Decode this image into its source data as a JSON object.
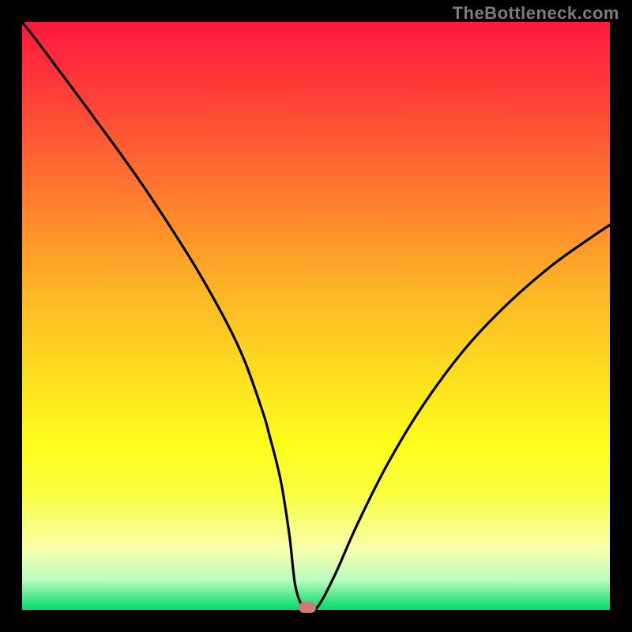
{
  "watermark": "TheBottleneck.com",
  "chart_data": {
    "type": "line",
    "title": "",
    "xlabel": "",
    "ylabel": "",
    "xlim": [
      0,
      100
    ],
    "ylim": [
      0,
      100
    ],
    "series": [
      {
        "name": "curve",
        "x": [
          0,
          2,
          5,
          10,
          15,
          20,
          25,
          30,
          35,
          38,
          41,
          42,
          44,
          45.5,
          46.5,
          48,
          50,
          53,
          57,
          62,
          68,
          75,
          82,
          90,
          97,
          100
        ],
        "values": [
          100,
          97.5,
          93.5,
          86.8,
          80,
          73,
          65.5,
          57.5,
          48.5,
          42,
          33.5,
          30,
          22,
          12.5,
          4,
          0.2,
          0.2,
          5.5,
          14.5,
          24.5,
          34.5,
          44,
          51.5,
          58.5,
          63.5,
          65.5
        ]
      }
    ],
    "marker": {
      "x": 48.5,
      "y": 0.4
    },
    "background_gradient": {
      "stops": [
        {
          "offset": 0.0,
          "color": "#fe183f"
        },
        {
          "offset": 0.14,
          "color": "#fe4436"
        },
        {
          "offset": 0.3,
          "color": "#fe7d2e"
        },
        {
          "offset": 0.45,
          "color": "#fdb326"
        },
        {
          "offset": 0.6,
          "color": "#fdde1f"
        },
        {
          "offset": 0.72,
          "color": "#fdfd1c"
        },
        {
          "offset": 0.8,
          "color": "#faff40"
        },
        {
          "offset": 0.9,
          "color": "#f7ffae"
        },
        {
          "offset": 0.95,
          "color": "#b7fcc0"
        },
        {
          "offset": 0.975,
          "color": "#5ae98e"
        },
        {
          "offset": 1.0,
          "color": "#00dd6e"
        }
      ]
    }
  }
}
